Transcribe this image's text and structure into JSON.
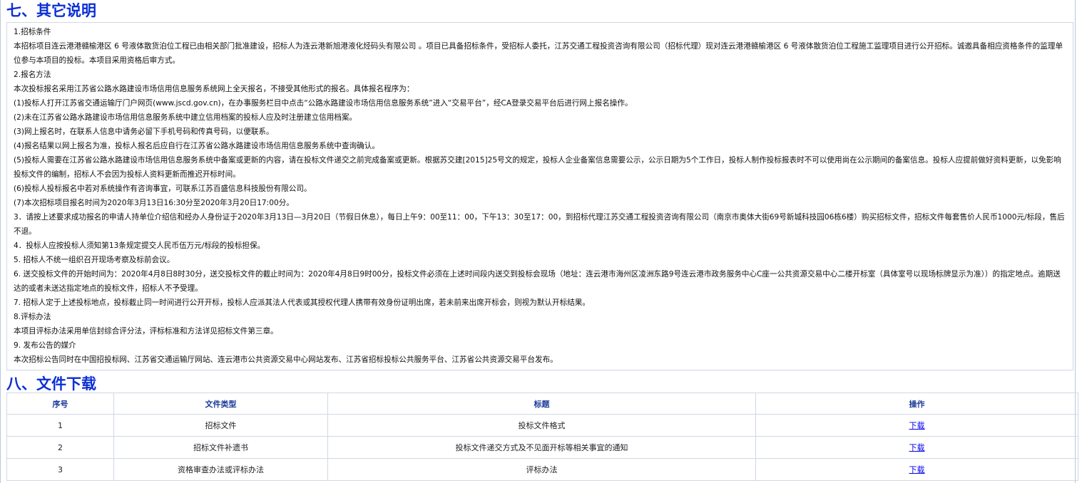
{
  "section7": {
    "title": "七、其它说明",
    "lines": [
      "1.招标条件",
      "本招标项目连云港港赣榆港区 6 号液体散货泊位工程已由相关部门批准建设，招标人为连云港新旭港液化烃码头有限公司 。项目已具备招标条件，受招标人委托，江苏交通工程投资咨询有限公司（招标代理）现对连云港港赣榆港区 6 号液体散货泊位工程施工监理项目进行公开招标。诚邀具备相应资格条件的监理单位参与本项目的投标。本项目采用资格后审方式。",
      "2.报名方法",
      "本次投标报名采用江苏省公路水路建设市场信用信息服务系统网上全天报名，不接受其他形式的报名。具体报名程序为：",
      "(1)投标人打开江苏省交通运输厅门户网页(www.jscd.gov.cn)，在办事服务栏目中点击“公路水路建设市场信用信息服务系统”进入“交易平台”，经CA登录交易平台后进行网上报名操作。",
      "(2)未在江苏省公路水路建设市场信用信息服务系统中建立信用档案的投标人应及时注册建立信用档案。",
      "(3)网上报名时，在联系人信息中请务必留下手机号码和传真号码，以便联系。",
      "(4)报名结果以网上报名为准，投标人报名后应自行在江苏省公路水路建设市场信用信息服务系统中查询确认。",
      "(5)投标人需要在江苏省公路水路建设市场信用信息服务系统中备案或更新的内容，请在投标文件递交之前完成备案或更新。根据苏交建[2015]25号文的规定，投标人企业备案信息需要公示，公示日期为5个工作日，投标人制作投标报表时不可以使用尚在公示期间的备案信息。投标人应提前做好资料更新，以免影响投标文件的编制，招标人不会因为投标人资料更新而推迟开标时间。",
      "(6)投标人投标报名中若对系统操作有咨询事宜，可联系江苏百盛信息科技股份有限公司。",
      "(7)本次招标项目报名时间为2020年3月13日16:30分至2020年3月20日17:00分。",
      "3．请按上述要求成功报名的申请人持单位介绍信和经办人身份证于2020年3月13日—3月20日（节假日休息），每日上午9：00至11：00，下午13：30至17：00，到招标代理江苏交通工程投资咨询有限公司（南京市奥体大街69号新城科技园06栋6楼）购买招标文件，招标文件每套售价人民币1000元/标段，售后不退。",
      "4．投标人应按投标人须知第13条规定提交人民币伍万元/标段的投标担保。",
      "5. 招标人不统一组织召开现场考察及标前会议。",
      "6. 送交投标文件的开始时间为：2020年4月8日8时30分，送交投标文件的截止时间为：2020年4月8日9时00分，投标文件必须在上述时间段内送交到投标会现场（地址：连云港市海州区凌洲东路9号连云港市政务服务中心C座一公共资源交易中心二楼开标室（具体室号以现场标牌显示为准））的指定地点。逾期送达的或者未送达指定地点的投标文件，招标人不予受理。",
      "7. 招标人定于上述投标地点，投标截止同一时间进行公开开标，投标人应派其法人代表或其授权代理人携带有效身份证明出席，若未前来出席开标会，则视为默认开标结果。",
      "8.评标办法",
      "本项目评标办法采用单信封综合评分法，评标标准和方法详见招标文件第三章。",
      "9. 发布公告的媒介",
      "本次招标公告同时在中国招投标网、江苏省交通运输厅网站、连云港市公共资源交易中心网站发布、江苏省招标投标公共服务平台、江苏省公共资源交易平台发布。"
    ]
  },
  "section8": {
    "title": "八、文件下载",
    "headers": [
      "序号",
      "文件类型",
      "标题",
      "操作"
    ],
    "rows": [
      [
        "1",
        "招标文件",
        "投标文件格式",
        "下载"
      ],
      [
        "2",
        "招标文件补遗书",
        "投标文件递交方式及不见面开标等相关事宜的通知",
        "下载"
      ],
      [
        "3",
        "资格审查办法或评标办法",
        "评标办法",
        "下载"
      ]
    ]
  }
}
